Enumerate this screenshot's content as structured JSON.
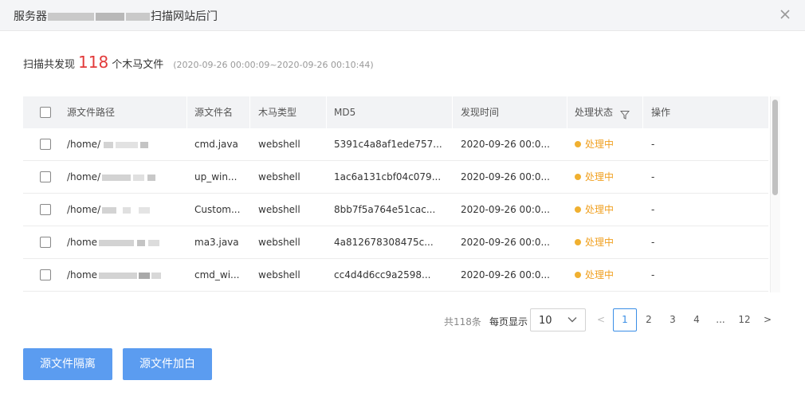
{
  "dialog": {
    "title_prefix": "服务器",
    "title_suffix": "扫描网站后门",
    "close_icon": "close-icon"
  },
  "summary": {
    "label_before": "扫描共发现",
    "count": "118",
    "label_after": "个木马文件",
    "time_range": "(2020-09-26 00:00:09~2020-09-26 00:10:44)"
  },
  "table": {
    "columns": {
      "path": "源文件路径",
      "name": "源文件名",
      "type": "木马类型",
      "md5": "MD5",
      "time": "发现时间",
      "status": "处理状态",
      "action": "操作"
    },
    "rows": [
      {
        "path": "/home/",
        "name": "cmd.java",
        "type": "webshell",
        "md5": "5391c4a8af1ede757...",
        "time": "2020-09-26 00:0...",
        "status": "处理中",
        "action": "-"
      },
      {
        "path": "/home/",
        "name": "up_win...",
        "type": "webshell",
        "md5": "1ac6a131cbf04c079...",
        "time": "2020-09-26 00:0...",
        "status": "处理中",
        "action": "-"
      },
      {
        "path": "/home/",
        "name": "Custom...",
        "type": "webshell",
        "md5": "8bb7f5a764e51cac...",
        "time": "2020-09-26 00:0...",
        "status": "处理中",
        "action": "-"
      },
      {
        "path": "/home",
        "name": "ma3.java",
        "type": "webshell",
        "md5": "4a812678308475c...",
        "time": "2020-09-26 00:0...",
        "status": "处理中",
        "action": "-"
      },
      {
        "path": "/home",
        "name": "cmd_wi...",
        "type": "webshell",
        "md5": "cc4d4d6cc9a2598...",
        "time": "2020-09-26 00:0...",
        "status": "处理中",
        "action": "-"
      }
    ],
    "status_color": "#f0b030"
  },
  "pagination": {
    "total": "共118条",
    "page_size_label": "每页显示",
    "page_size": "10",
    "prev": "<",
    "next": ">",
    "pages": [
      "1",
      "2",
      "3",
      "4",
      "...",
      "12"
    ],
    "current": "1"
  },
  "buttons": {
    "isolate": "源文件隔离",
    "whitelist": "源文件加白"
  },
  "colors": {
    "accent": "#3a8ee6",
    "primary_button": "#5b9cf0",
    "count": "#e23a3a",
    "warning": "#f0a020"
  }
}
